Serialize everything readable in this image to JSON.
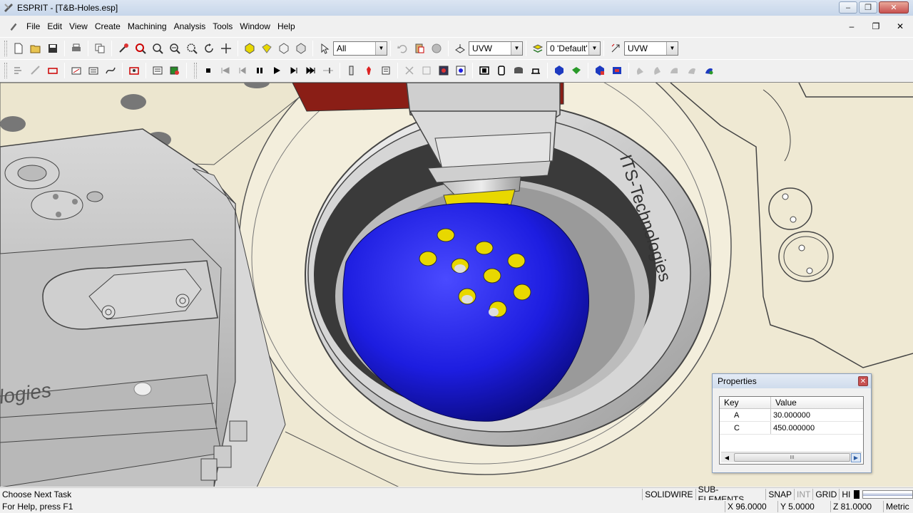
{
  "window": {
    "title": "ESPRIT - [T&B-Holes.esp]",
    "min_label": "–",
    "max_label": "❐",
    "close_label": "✕"
  },
  "menu": {
    "items": [
      "File",
      "Edit",
      "View",
      "Create",
      "Machining",
      "Analysis",
      "Tools",
      "Window",
      "Help"
    ],
    "mdi_min": "–",
    "mdi_restore": "❐",
    "mdi_close": "✕"
  },
  "toolbar": {
    "select_filter": "All",
    "work_plane": "UVW",
    "layer": "0 'Default'",
    "view_plane": "UVW"
  },
  "viewport": {
    "engraving_main": "ITS-Technologies",
    "engraving_left": "logies"
  },
  "properties": {
    "title": "Properties",
    "close_label": "✕",
    "headers": {
      "key": "Key",
      "value": "Value"
    },
    "rows": [
      {
        "key": "A",
        "value": "30.000000"
      },
      {
        "key": "C",
        "value": "450.000000"
      }
    ],
    "scroll_thumb": "III",
    "scroll_left": "◀",
    "scroll_right": "▶"
  },
  "status": {
    "task": "Choose Next Task",
    "help": "For Help, press F1",
    "modes": [
      {
        "label": "SOLIDWIRE",
        "active": true
      },
      {
        "label": "SUB-ELEMENTS",
        "active": true
      },
      {
        "label": "SNAP",
        "active": true
      },
      {
        "label": "INT",
        "active": false
      },
      {
        "label": "GRID",
        "active": true
      },
      {
        "label": "HI",
        "active": true
      }
    ],
    "x": "X 96.0000",
    "y": "Y 5.0000",
    "z": "Z 81.0000",
    "units": "Metric"
  },
  "colors": {
    "sphere": "#1d1de0",
    "holes": "#e8d800",
    "machine_body": "#c8c8c8",
    "table": "#efe9d3",
    "head_block": "#8a1e16"
  }
}
